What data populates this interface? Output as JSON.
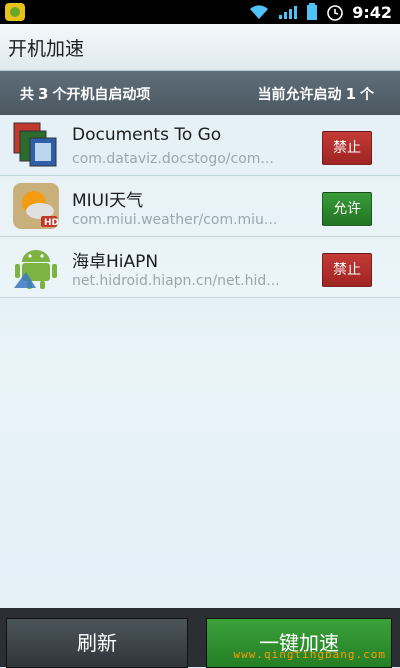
{
  "status_bar": {
    "time": "9:42"
  },
  "title_bar": {
    "title": "开机加速"
  },
  "summary": {
    "left_prefix": "共",
    "left_count": "3",
    "left_suffix": "个开机自启动项",
    "right_prefix": "当前允许启动",
    "right_count": "1",
    "right_suffix": "个"
  },
  "apps": [
    {
      "name": "Documents To Go",
      "package": "com.dataviz.docstogo/com...",
      "action": "禁止",
      "icon": "documents-to-go-icon"
    },
    {
      "name": "MIUI天气",
      "package": "com.miui.weather/com.miu...",
      "action": "允许",
      "icon": "weather-icon"
    },
    {
      "name": "海卓HiAPN",
      "package": "net.hidroid.hiapn.cn/net.hid...",
      "action": "禁止",
      "icon": "android-icon"
    }
  ],
  "bottom_bar": {
    "refresh_label": "刷新",
    "boost_label": "一键加速"
  },
  "watermark": "www.qingtingbang.com",
  "colors": {
    "deny": "#b0302c",
    "allow": "#2f8a2f",
    "summary_bg": "#56636d"
  }
}
